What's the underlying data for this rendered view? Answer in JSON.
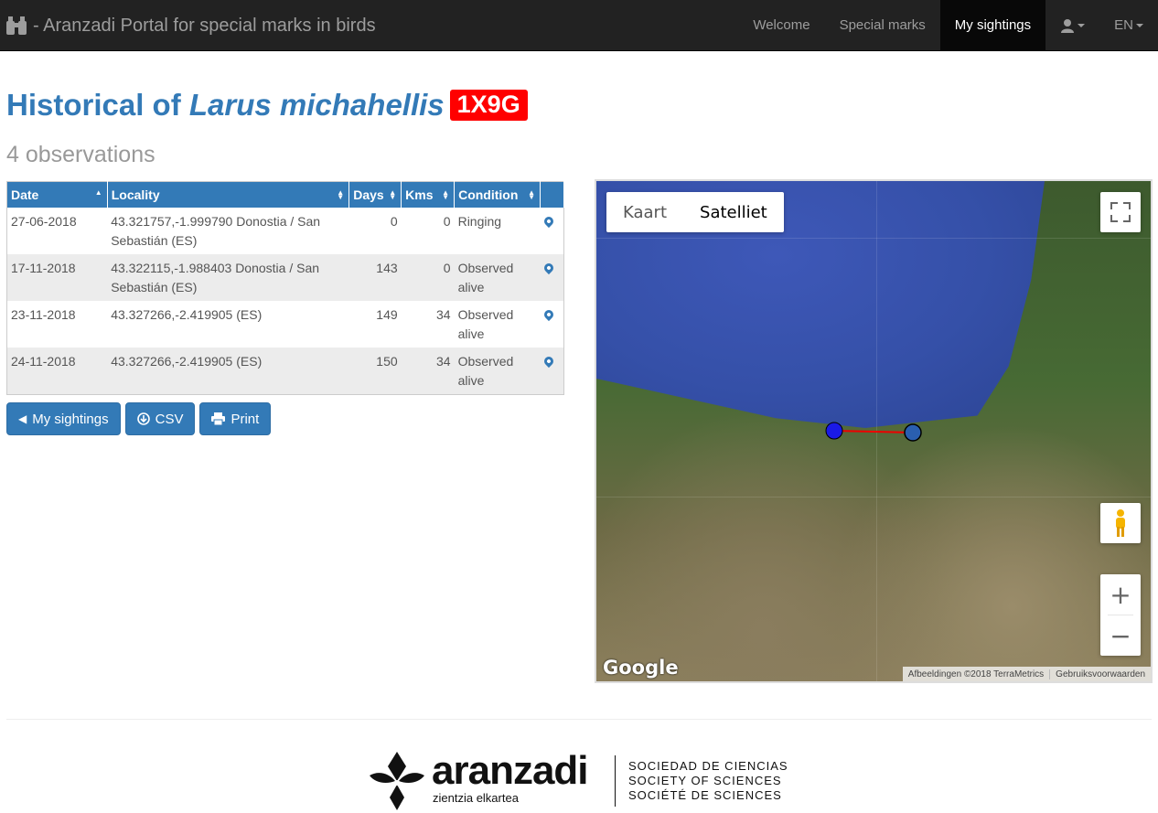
{
  "navbar": {
    "brand_icon": "binoculars-icon",
    "brand_text": "- Aranzadi Portal for special marks in birds",
    "items": [
      {
        "label": "Welcome",
        "active": false
      },
      {
        "label": "Special marks",
        "active": false
      },
      {
        "label": "My sightings",
        "active": true
      }
    ],
    "user_icon": "user-icon",
    "language": "EN"
  },
  "header": {
    "title_prefix": "Historical of",
    "species": "Larus michahellis",
    "ring_code": "1X9G",
    "ring_color": "#ff0000",
    "subtitle": "4 observations"
  },
  "table": {
    "columns": [
      "Date",
      "Locality",
      "Days",
      "Kms",
      "Condition"
    ],
    "rows": [
      {
        "date": "27-06-2018",
        "locality": "43.321757,-1.999790 Donostia / San Sebastián (ES)",
        "days": "0",
        "kms": "0",
        "condition": "Ringing"
      },
      {
        "date": "17-11-2018",
        "locality": "43.322115,-1.988403 Donostia / San Sebastián (ES)",
        "days": "143",
        "kms": "0",
        "condition": "Observed alive"
      },
      {
        "date": "23-11-2018",
        "locality": "43.327266,-2.419905 (ES)",
        "days": "149",
        "kms": "34",
        "condition": "Observed alive"
      },
      {
        "date": "24-11-2018",
        "locality": "43.327266,-2.419905 (ES)",
        "days": "150",
        "kms": "34",
        "condition": "Observed alive"
      }
    ]
  },
  "buttons": {
    "back": "My sightings",
    "csv": "CSV",
    "print": "Print"
  },
  "map": {
    "type_map": "Kaart",
    "type_satellite": "Satelliet",
    "selected_type": "Satelliet",
    "google_label": "Google",
    "attribution": "Afbeeldingen ©2018 TerraMetrics",
    "terms": "Gebruiksvoorwaarden",
    "zoom_in": "+",
    "zoom_out": "−"
  },
  "footer": {
    "logo_word": "aranzadi",
    "logo_sub": "zientzia elkartea",
    "line1": "SOCIEDAD DE CIENCIAS",
    "line2": "SOCIETY OF SCIENCES",
    "line3": "SOCIÉTÉ DE SCIENCES"
  },
  "colors": {
    "primary": "#337ab7",
    "navbar": "#222222",
    "tag": "#ff0000"
  }
}
